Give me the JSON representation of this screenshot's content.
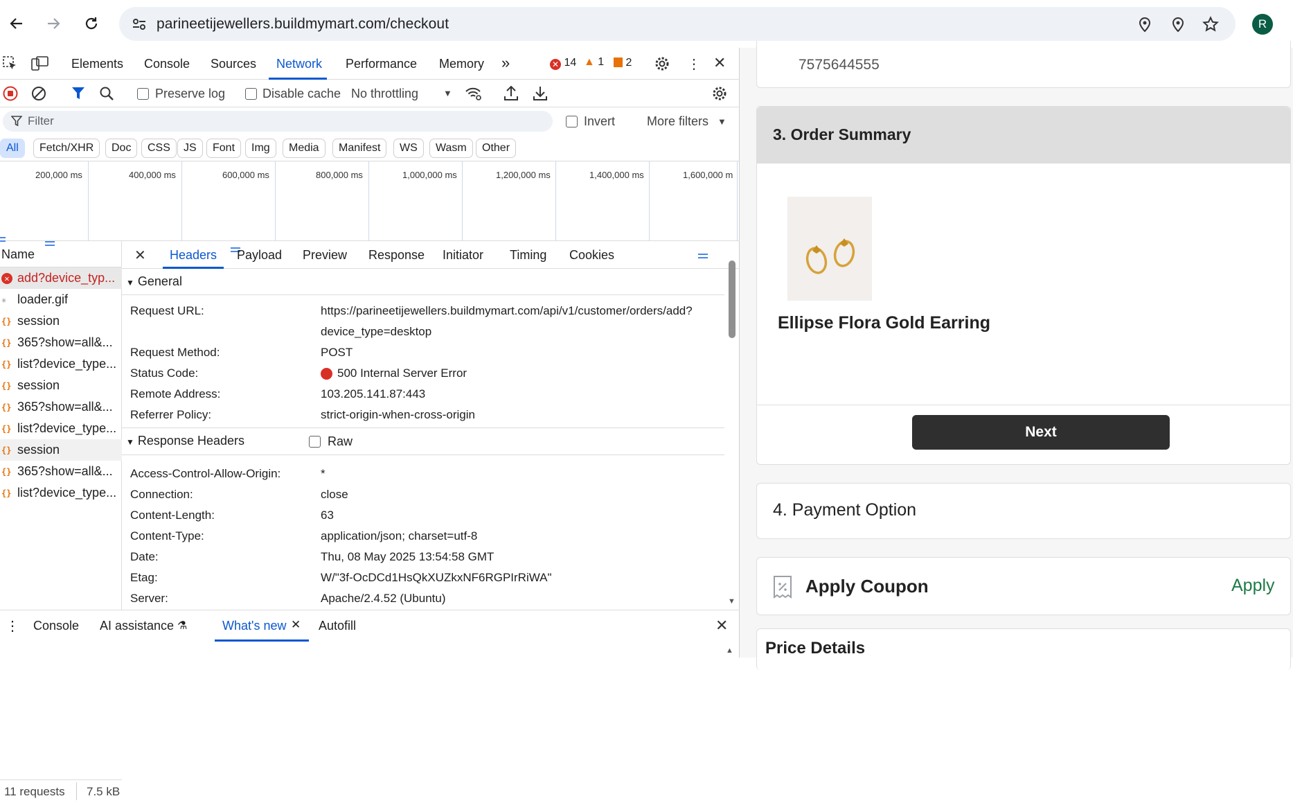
{
  "browser": {
    "url": "parineetijewellers.buildmymart.com/checkout",
    "avatar_letter": "R"
  },
  "devtools": {
    "tabs": [
      "Elements",
      "Console",
      "Sources",
      "Network",
      "Performance",
      "Memory"
    ],
    "active_tab": "Network",
    "errors": "14",
    "warnings": "1",
    "issues": "2",
    "toolbar": {
      "preserve_log": "Preserve log",
      "disable_cache": "Disable cache",
      "throttling": "No throttling"
    },
    "filter": {
      "placeholder": "Filter",
      "invert": "Invert",
      "more_filters": "More filters"
    },
    "type_filters": [
      "All",
      "Fetch/XHR",
      "Doc",
      "CSS",
      "JS",
      "Font",
      "Img",
      "Media",
      "Manifest",
      "WS",
      "Wasm",
      "Other"
    ],
    "timeline_ticks": [
      "200,000 ms",
      "400,000 ms",
      "600,000 ms",
      "800,000 ms",
      "1,000,000 ms",
      "1,200,000 ms",
      "1,400,000 ms",
      "1,600,000 m"
    ],
    "name_header": "Name",
    "requests": [
      {
        "name": "add?device_typ...",
        "kind": "error"
      },
      {
        "name": "loader.gif",
        "kind": "gif"
      },
      {
        "name": "session",
        "kind": "json"
      },
      {
        "name": "365?show=all&...",
        "kind": "json"
      },
      {
        "name": "list?device_type...",
        "kind": "json"
      },
      {
        "name": "session",
        "kind": "json"
      },
      {
        "name": "365?show=all&...",
        "kind": "json"
      },
      {
        "name": "list?device_type...",
        "kind": "json"
      },
      {
        "name": "session",
        "kind": "json"
      },
      {
        "name": "365?show=all&...",
        "kind": "json"
      },
      {
        "name": "list?device_type...",
        "kind": "json"
      }
    ],
    "status": {
      "requests": "11 requests",
      "size": "7.5 kB"
    },
    "detail_tabs": [
      "Headers",
      "Payload",
      "Preview",
      "Response",
      "Initiator",
      "Timing",
      "Cookies"
    ],
    "general": {
      "title": "General",
      "request_url_key": "Request URL:",
      "request_url_line1": "https://parineetijewellers.buildmymart.com/api/v1/customer/orders/add?",
      "request_url_line2": "device_type=desktop",
      "method_key": "Request Method:",
      "method": "POST",
      "status_key": "Status Code:",
      "status": "500 Internal Server Error",
      "remote_key": "Remote Address:",
      "remote": "103.205.141.87:443",
      "referrer_key": "Referrer Policy:",
      "referrer": "strict-origin-when-cross-origin"
    },
    "response_headers": {
      "title": "Response Headers",
      "raw": "Raw",
      "rows": [
        {
          "k": "Access-Control-Allow-Origin:",
          "v": "*"
        },
        {
          "k": "Connection:",
          "v": "close"
        },
        {
          "k": "Content-Length:",
          "v": "63"
        },
        {
          "k": "Content-Type:",
          "v": "application/json; charset=utf-8"
        },
        {
          "k": "Date:",
          "v": "Thu, 08 May 2025 13:54:58 GMT"
        },
        {
          "k": "Etag:",
          "v": "W/\"3f-OcDCd1HsQkXUZkxNF6RGPIrRiWA\""
        },
        {
          "k": "Server:",
          "v": "Apache/2.4.52 (Ubuntu)"
        }
      ]
    },
    "drawer_tabs": {
      "console": "Console",
      "ai": "AI assistance",
      "whats_new": "What's new",
      "autofill": "Autofill"
    }
  },
  "page": {
    "phone": "7575644555",
    "order_summary_title": "3. Order Summary",
    "product_name": "Ellipse Flora Gold Earring",
    "next_label": "Next",
    "payment_title": "4. Payment Option",
    "coupon_label": "Apply Coupon",
    "coupon_action": "Apply",
    "price_details": "Price Details",
    "colors": {
      "accent_green": "#1e7a46",
      "button_dark": "#2f2f2f",
      "devtools_blue": "#0b57d0",
      "error_red": "#d93025"
    }
  }
}
